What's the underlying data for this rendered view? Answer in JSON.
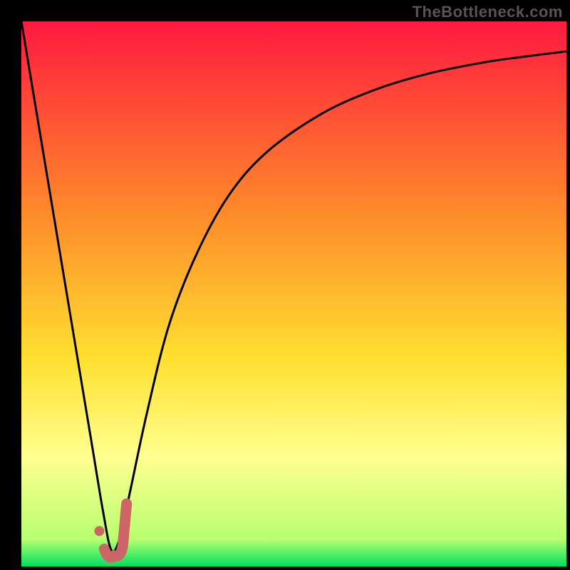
{
  "watermark": "TheBottleneck.com",
  "colors": {
    "gradient_top": "#ff1a40",
    "gradient_orange": "#ff8a2a",
    "gradient_yellow": "#ffe030",
    "gradient_paleyellow": "#ffff90",
    "gradient_bottom": "#00e060",
    "frame": "#000000",
    "curve": "#000000",
    "marker": "#cc6666"
  },
  "chart_data": {
    "type": "line",
    "title": "",
    "xlabel": "",
    "ylabel": "",
    "xlim": [
      0,
      100
    ],
    "ylim": [
      0,
      100
    ],
    "series": [
      {
        "name": "bottleneck-curve",
        "x": [
          0,
          5,
          10,
          13,
          15,
          16.5,
          18,
          20,
          23,
          27,
          32,
          38,
          45,
          55,
          65,
          75,
          85,
          92,
          100
        ],
        "values": [
          100,
          70,
          40,
          22,
          10,
          3,
          5,
          14,
          28,
          44,
          57,
          68,
          76,
          83,
          87.5,
          90.5,
          92.5,
          93.5,
          94.5
        ]
      }
    ],
    "annotations": [
      {
        "name": "j-marker",
        "x_range": [
          14.5,
          19
        ],
        "y_range": [
          2,
          12
        ]
      }
    ],
    "background_gradient_stops": [
      {
        "offset": 0.0,
        "color": "#ff1a40"
      },
      {
        "offset": 0.35,
        "color": "#ff8a2a"
      },
      {
        "offset": 0.62,
        "color": "#ffe030"
      },
      {
        "offset": 0.8,
        "color": "#ffff90"
      },
      {
        "offset": 0.95,
        "color": "#b8ff70"
      },
      {
        "offset": 1.0,
        "color": "#00e060"
      }
    ]
  }
}
